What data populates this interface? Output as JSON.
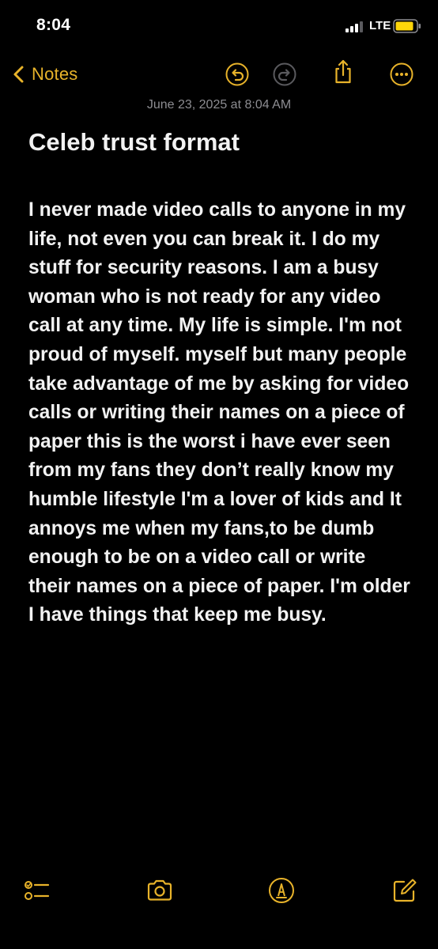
{
  "status_bar": {
    "time": "8:04",
    "network": "LTE",
    "icons": [
      "signal-bars-icon",
      "battery-icon"
    ]
  },
  "nav": {
    "back_label": "Notes",
    "icons": [
      "chevron-left-icon",
      "undo-icon",
      "redo-icon",
      "share-icon",
      "more-icon"
    ]
  },
  "note": {
    "date": "June 23, 2025 at 8:04 AM",
    "title": "Celeb trust format",
    "body": "I never made video calls to anyone in my life, not even you can break it. I do my stuff for security reasons. I am a busy woman who is not ready for any video call at any time. My life is simple. I'm not proud of myself. myself but many people take advantage of me by asking for video calls or writing their names on a piece of paper this is the worst i have ever seen from my fans they don’t really know my humble lifestyle I'm a lover of kids and It annoys me when my fans,to be dumb enough to be on a video call or write their names on a piece of paper. I'm older I have things that keep me busy."
  },
  "toolbar": {
    "icons": [
      "checklist-icon",
      "camera-icon",
      "markup-icon",
      "compose-icon"
    ]
  },
  "colors": {
    "accent": "#e8b32a",
    "background": "#000000",
    "text": "#f2f2f2",
    "secondary_text": "#8d8d92",
    "disabled_icon": "#5a5a5e",
    "battery_fill": "#ffd60a"
  }
}
